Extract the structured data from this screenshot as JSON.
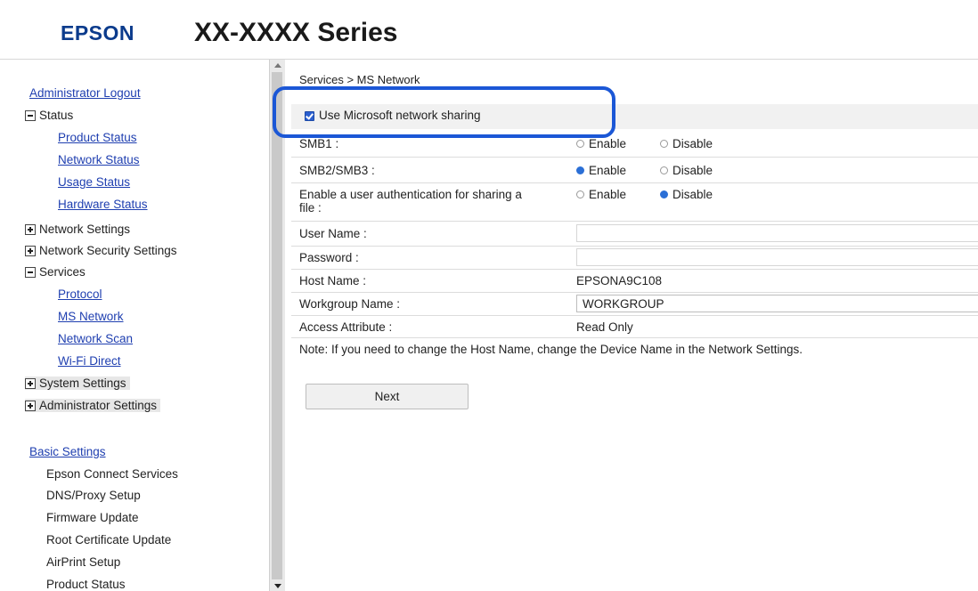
{
  "header": {
    "brand": "EPSON",
    "model": "XX-XXXX Series"
  },
  "sidebar": {
    "admin_logout": "Administrator Logout",
    "status": {
      "label": "Status",
      "items": [
        "Product Status",
        "Network Status",
        "Usage Status",
        "Hardware Status"
      ]
    },
    "network_settings": "Network Settings",
    "network_security_settings": "Network Security Settings",
    "services": {
      "label": "Services",
      "items": [
        "Protocol",
        "MS Network",
        "Network Scan",
        "Wi-Fi Direct"
      ]
    },
    "system_settings": "System Settings",
    "administrator_settings": "Administrator Settings",
    "basic_settings": {
      "label": "Basic Settings",
      "items": [
        "Epson Connect Services",
        "DNS/Proxy Setup",
        "Firmware Update",
        "Root Certificate Update",
        "AirPrint Setup",
        "Product Status"
      ]
    }
  },
  "main": {
    "breadcrumb": "Services > MS Network",
    "use_ms_sharing": {
      "label": "Use Microsoft network sharing",
      "checked": true
    },
    "smb1": {
      "label": "SMB1 :",
      "enable": "Enable",
      "disable": "Disable"
    },
    "smb23": {
      "label": "SMB2/SMB3 :",
      "enable": "Enable",
      "disable": "Disable",
      "selected": "Enable"
    },
    "user_auth": {
      "label_line1": "Enable a user authentication for sharing a",
      "label_line2": "file :",
      "enable": "Enable",
      "disable": "Disable",
      "selected": "Disable"
    },
    "user_name": {
      "label": "User Name :",
      "value": ""
    },
    "password": {
      "label": "Password :",
      "value": ""
    },
    "host_name": {
      "label": "Host Name :",
      "value": "EPSONA9C108"
    },
    "workgroup_name": {
      "label": "Workgroup Name :",
      "value": "WORKGROUP"
    },
    "access_attribute": {
      "label": "Access Attribute :",
      "value": "Read Only"
    },
    "note": "Note: If you need to change the Host Name, change the Device Name in the Network Settings.",
    "next_button": "Next"
  },
  "colors": {
    "link": "#1f3fb0",
    "brand": "#0b3b8c",
    "highlight": "#1b57d6",
    "radio_selected": "#2b6fd6"
  }
}
